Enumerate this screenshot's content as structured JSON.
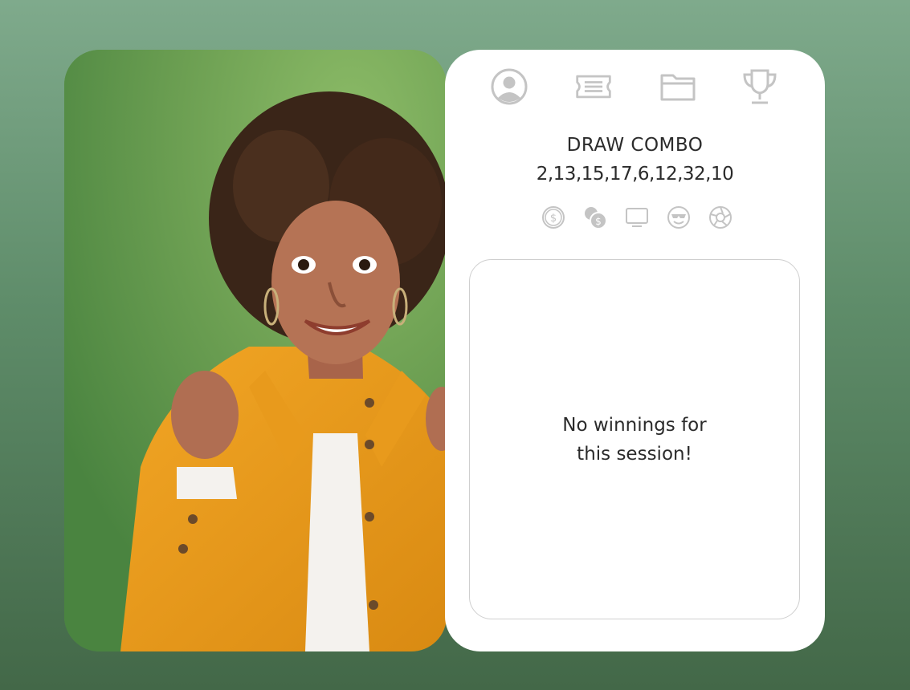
{
  "nav": {
    "items": [
      {
        "icon": "user-icon"
      },
      {
        "icon": "ticket-icon"
      },
      {
        "icon": "folder-icon"
      },
      {
        "icon": "trophy-icon"
      }
    ]
  },
  "draw": {
    "title": "DRAW COMBO",
    "numbers": "2,13,15,17,6,12,32,10"
  },
  "filters": [
    {
      "icon": "dollar-coin-icon"
    },
    {
      "icon": "coins-icon"
    },
    {
      "icon": "monitor-icon"
    },
    {
      "icon": "cool-face-icon"
    },
    {
      "icon": "aperture-icon"
    }
  ],
  "results": {
    "empty_message": "No winnings for this session!"
  },
  "colors": {
    "icon_gray": "#c4c4c4",
    "text": "#2b2b2b",
    "card_bg": "#ffffff"
  }
}
